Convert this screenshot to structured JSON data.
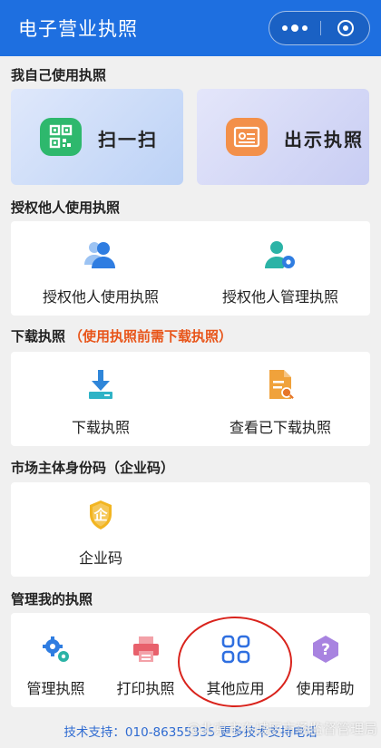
{
  "header": {
    "title": "电子营业执照"
  },
  "sections": {
    "self_use": "我自己使用执照",
    "authorize": "授权他人使用执照",
    "download": "下载执照",
    "download_note": "（使用执照前需下载执照）",
    "enterprise_code": "市场主体身份码（企业码）",
    "manage": "管理我的执照"
  },
  "self_use": {
    "scan_label": "扫一扫",
    "show_label": "出示执照"
  },
  "authorize": {
    "use_label": "授权他人使用执照",
    "manage_label": "授权他人管理执照"
  },
  "download": {
    "download_label": "下载执照",
    "view_label": "查看已下载执照"
  },
  "enterprise": {
    "code_label": "企业码",
    "icon_char": "企"
  },
  "manage": {
    "items": [
      {
        "label": "管理执照"
      },
      {
        "label": "打印执照"
      },
      {
        "label": "其他应用"
      },
      {
        "label": "使用帮助"
      }
    ]
  },
  "footer": {
    "support_text": "技术支持：010-86355335",
    "more_link": "更多技术支持电话"
  },
  "watermark": "@北京市东城区市场监督管理局",
  "colors": {
    "header": "#1e6fe0",
    "note": "#e8551a",
    "link": "#2f6bd1",
    "highlight": "#d9231c"
  }
}
